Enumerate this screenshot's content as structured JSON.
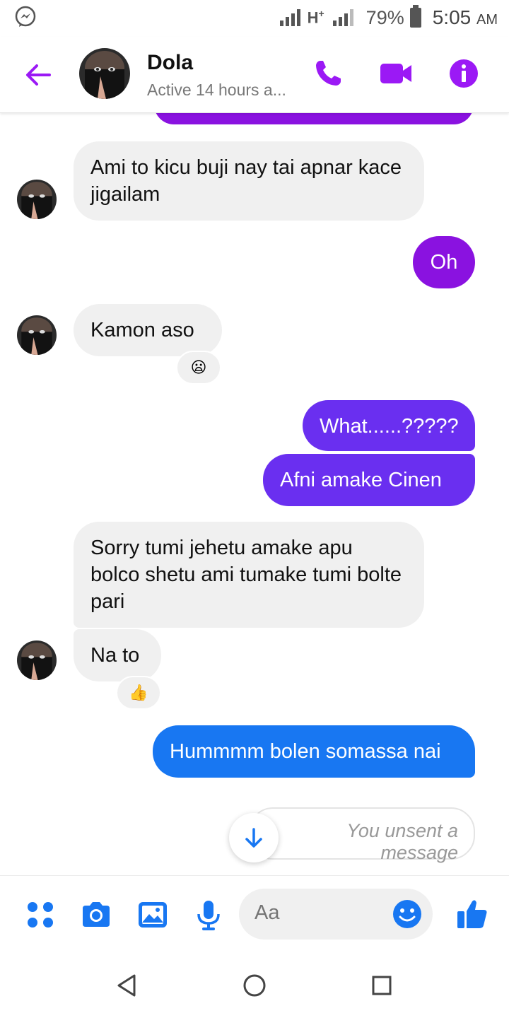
{
  "status_bar": {
    "network": "H",
    "network_sup": "+",
    "battery": "79%",
    "time": "5:05",
    "ampm": "AM"
  },
  "header": {
    "contact_name": "Dola",
    "contact_status": "Active 14 hours a..."
  },
  "messages": [
    {
      "side": "in",
      "text": "Ami to kicu buji nay tai apnar kace jigailam"
    },
    {
      "side": "out",
      "text": "Oh",
      "color": "#8a12e0"
    },
    {
      "side": "in",
      "text": "Kamon aso",
      "reaction": "😦"
    },
    {
      "side": "out",
      "text": "What......?????",
      "color": "#6a2ff0"
    },
    {
      "side": "out",
      "text": "Afni amake Cinen",
      "color": "#6a2ff0"
    },
    {
      "side": "in",
      "text": "Sorry tumi jehetu amake apu bolco shetu ami tumake tumi bolte pari"
    },
    {
      "side": "in",
      "text": "Na to",
      "reaction": "👍"
    },
    {
      "side": "out",
      "text": "Hummmm bolen somassa nai",
      "color": "#1877f2"
    },
    {
      "side": "system",
      "text": "You unsent a message"
    }
  ],
  "composer": {
    "placeholder": "Aa"
  },
  "colors": {
    "accent_purple": "#9b19f5",
    "blue": "#1877f2"
  },
  "icons": [
    "messenger-icon",
    "back-arrow-icon",
    "phone-icon",
    "video-icon",
    "info-icon",
    "arrow-down-icon",
    "apps-icon",
    "camera-icon",
    "gallery-icon",
    "mic-icon",
    "smiley-icon",
    "thumbs-up-icon",
    "nav-back-icon",
    "nav-home-icon",
    "nav-recents-icon"
  ]
}
